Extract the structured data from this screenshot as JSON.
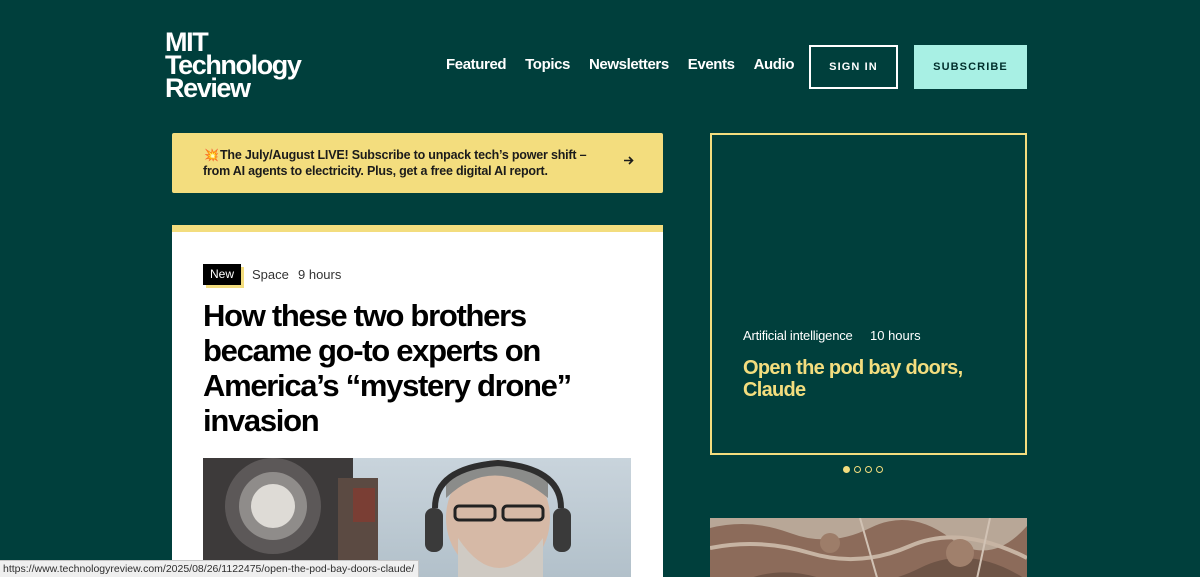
{
  "header": {
    "logo_lines": [
      "MIT",
      "Technology",
      "Review"
    ],
    "nav": [
      "Featured",
      "Topics",
      "Newsletters",
      "Events",
      "Audio"
    ],
    "sign_in_label": "SIGN IN",
    "subscribe_label": "SUBSCRIBE"
  },
  "promo": {
    "emoji": "💥",
    "text": "The July/August LIVE! Subscribe to unpack tech’s power shift – from AI agents to electricity. Plus, get a free digital AI report.",
    "arrow_icon": "arrow-right-icon"
  },
  "main_article": {
    "badge": "New",
    "topic": "Space",
    "time": "9 hours",
    "title": "How these two brothers became go-to experts on America’s “mystery drone” invasion"
  },
  "feature_article": {
    "topic": "Artificial intelligence",
    "time": "10 hours",
    "title": "Open the pod bay doors, Claude"
  },
  "carousel": {
    "total": 4,
    "active_index": 0
  },
  "statusbar": {
    "url": "https://www.technologyreview.com/2025/08/26/1122475/open-the-pod-bay-doors-claude/"
  },
  "colors": {
    "background": "#003f3c",
    "accent_yellow": "#f3dd7e",
    "subscribe_bg": "#a8f0e4",
    "white": "#ffffff"
  }
}
